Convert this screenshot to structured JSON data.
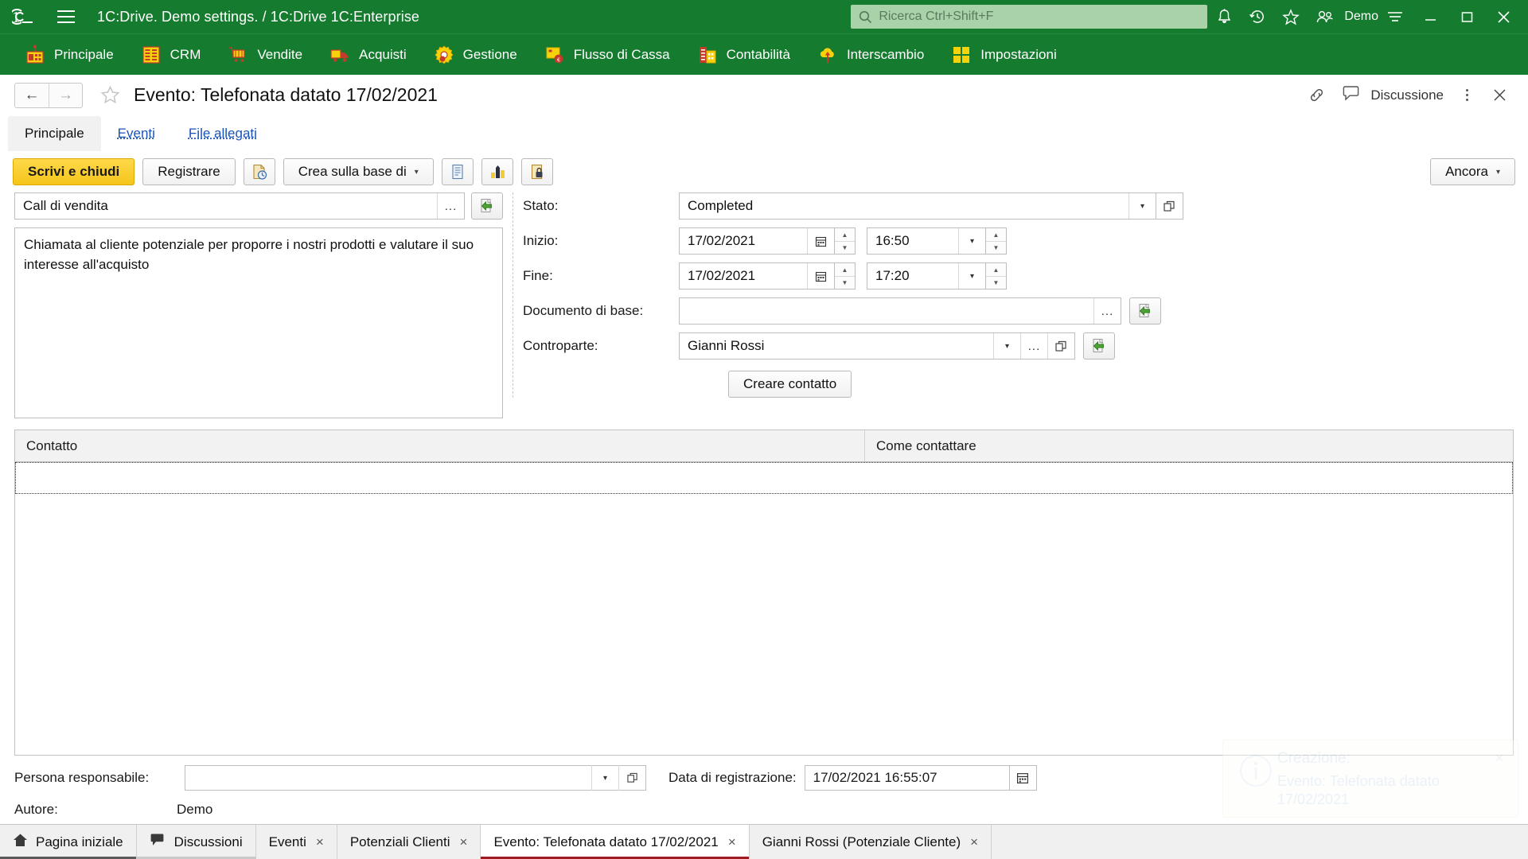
{
  "titlebar": {
    "logo": "1c-logo-icon",
    "menu_icon": "hamburger-menu-icon",
    "app_title": "1C:Drive. Demo settings. / 1C:Drive 1C:Enterprise",
    "search_placeholder": "Ricerca Ctrl+Shift+F",
    "icons": [
      {
        "name": "notifications-bell-icon"
      },
      {
        "name": "history-clock-icon"
      },
      {
        "name": "favorites-star-icon"
      },
      {
        "name": "users-icon"
      }
    ],
    "user_name": "Demo",
    "options_icon": "options-lines-icon",
    "window_controls": {
      "minimize": "minimize-icon",
      "maximize": "maximize-icon",
      "close": "close-icon"
    }
  },
  "menubar": {
    "items": [
      {
        "label": "Principale",
        "icon": "principale-icon"
      },
      {
        "label": "CRM",
        "icon": "crm-icon"
      },
      {
        "label": "Vendite",
        "icon": "vendite-cart-icon"
      },
      {
        "label": "Acquisti",
        "icon": "acquisti-truck-icon"
      },
      {
        "label": "Gestione",
        "icon": "gestione-gear-icon"
      },
      {
        "label": "Flusso di Cassa",
        "icon": "flusso-cassa-icon"
      },
      {
        "label": "Contabilità",
        "icon": "contabilita-icon"
      },
      {
        "label": "Interscambio",
        "icon": "interscambio-cloud-icon"
      },
      {
        "label": "Impostazioni",
        "icon": "impostazioni-icon"
      }
    ]
  },
  "pagehead": {
    "back_label": "←",
    "forward_label": "→",
    "favorite_icon": "star-outline-icon",
    "title": "Evento: Telefonata datato 17/02/2021",
    "link_icon": "link-chain-icon",
    "discussion_icon": "discussion-bubble-icon",
    "discussion_label": "Discussione",
    "more_icon": "kebab-menu-icon",
    "close_icon": "close-icon"
  },
  "formtabs": [
    {
      "label": "Principale",
      "active": true
    },
    {
      "label": "Eventi",
      "active": false
    },
    {
      "label": "File allegati",
      "active": false
    }
  ],
  "toolbar": {
    "save_close_label": "Scrivi e chiudi",
    "register_label": "Registrare",
    "history_icon": "document-history-icon",
    "create_based_label": "Crea sulla base di",
    "create_based_caret": "▾",
    "report_icon": "report-document-icon",
    "chart_icon": "chart-bar-icon",
    "lock_icon": "document-lock-icon",
    "more_label": "Ancora",
    "more_caret": "▾"
  },
  "form": {
    "subject_value": "Call di vendita",
    "subject_dots": "...",
    "subject_open_icon": "open-green-arrow-icon",
    "description_value": "Chiamata al cliente potenziale per proporre i nostri prodotti e valutare il suo interesse all'acquisto",
    "fields": {
      "stato_label": "Stato:",
      "stato_value": "Completed",
      "inizio_label": "Inizio:",
      "inizio_date": "17/02/2021",
      "inizio_time": "16:50",
      "fine_label": "Fine:",
      "fine_date": "17/02/2021",
      "fine_time": "17:20",
      "documento_label": "Documento di base:",
      "documento_value": "",
      "controparte_label": "Controparte:",
      "controparte_value": "Gianni Rossi"
    },
    "create_contact_label": "Creare contatto"
  },
  "table": {
    "columns": [
      "Contatto",
      "Come contattare"
    ],
    "rows": [
      {
        "contatto": "",
        "come_contattare": ""
      }
    ]
  },
  "footer": {
    "responsible_label": "Persona responsabile:",
    "responsible_value": "",
    "regdate_label": "Data di registrazione:",
    "regdate_value": "17/02/2021 16:55:07",
    "calendar_icon": "calendar-icon",
    "author_label": "Autore:",
    "author_value": "Demo"
  },
  "notification": {
    "icon": "info-circle-icon",
    "title": "Creazione:",
    "body": "Evento: Telefonata datato 17/02/2021",
    "close": "×"
  },
  "taskbar": {
    "tabs": [
      {
        "label": "Pagina iniziale",
        "icon": "home-icon",
        "closable": false,
        "active": false,
        "kind": "home"
      },
      {
        "label": "Discussioni",
        "icon": "discussion-bubble-icon",
        "closable": false,
        "active": false,
        "kind": "disc"
      },
      {
        "label": "Eventi",
        "icon": "",
        "closable": true,
        "active": false,
        "kind": ""
      },
      {
        "label": "Potenziali Clienti",
        "icon": "",
        "closable": true,
        "active": false,
        "kind": ""
      },
      {
        "label": "Evento: Telefonata datato 17/02/2021",
        "icon": "",
        "closable": true,
        "active": true,
        "kind": ""
      },
      {
        "label": "Gianni Rossi (Potenziale Cliente)",
        "icon": "",
        "closable": true,
        "active": false,
        "kind": ""
      }
    ],
    "close_glyph": "×"
  },
  "colors": {
    "brand_green": "#157b2f",
    "accent_yellow": "#f5c51b",
    "active_tab_underline": "#9e1b22",
    "link_blue": "#1a54b8"
  }
}
